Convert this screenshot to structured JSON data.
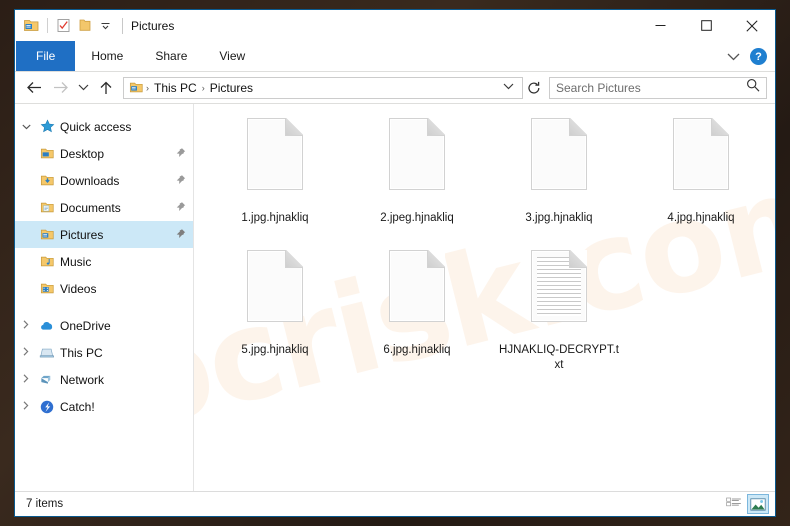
{
  "window": {
    "title": "Pictures",
    "quick_access_icons": [
      "folder-properties-icon",
      "checklist-icon",
      "folder-icon",
      "chevron-down-icon"
    ],
    "controls": {
      "minimize": "─",
      "maximize": "□",
      "close": "✕"
    }
  },
  "ribbon": {
    "tabs": [
      {
        "label": "File",
        "active_style": "file"
      },
      {
        "label": "Home"
      },
      {
        "label": "Share"
      },
      {
        "label": "View"
      }
    ],
    "collapse_label": "⌄",
    "help_label": "?"
  },
  "address": {
    "back": "←",
    "forward": "→",
    "recent": "⌄",
    "up": "↑",
    "crumbs": [
      "This PC",
      "Pictures"
    ],
    "separator": "›",
    "dropdown": "⌄",
    "refresh": "↻"
  },
  "search": {
    "placeholder": "Search Pictures",
    "icon": "search-icon"
  },
  "sidebar": {
    "items": [
      {
        "label": "Quick access",
        "icon": "star-icon",
        "expander": "⌄",
        "level": 0,
        "pinned": false,
        "selected": false
      },
      {
        "label": "Desktop",
        "icon": "folder-desktop-icon",
        "expander": "",
        "level": 1,
        "pinned": true,
        "selected": false
      },
      {
        "label": "Downloads",
        "icon": "folder-downloads-icon",
        "expander": "",
        "level": 1,
        "pinned": true,
        "selected": false
      },
      {
        "label": "Documents",
        "icon": "folder-documents-icon",
        "expander": "",
        "level": 1,
        "pinned": true,
        "selected": false
      },
      {
        "label": "Pictures",
        "icon": "folder-pictures-icon",
        "expander": "",
        "level": 1,
        "pinned": true,
        "selected": true
      },
      {
        "label": "Music",
        "icon": "folder-music-icon",
        "expander": "",
        "level": 1,
        "pinned": false,
        "selected": false
      },
      {
        "label": "Videos",
        "icon": "folder-videos-icon",
        "expander": "",
        "level": 1,
        "pinned": false,
        "selected": false
      },
      {
        "label": "OneDrive",
        "icon": "onedrive-cloud-icon",
        "expander": "›",
        "level": 0,
        "pinned": false,
        "selected": false
      },
      {
        "label": "This PC",
        "icon": "this-pc-icon",
        "expander": "›",
        "level": 0,
        "pinned": false,
        "selected": false
      },
      {
        "label": "Network",
        "icon": "network-icon",
        "expander": "›",
        "level": 0,
        "pinned": false,
        "selected": false
      },
      {
        "label": "Catch!",
        "icon": "catch-app-icon",
        "expander": "›",
        "level": 0,
        "pinned": false,
        "selected": false
      }
    ],
    "pin_glyph": "📌"
  },
  "files": [
    {
      "name": "1.jpg.hjnakliq",
      "icon": "blank-page-icon"
    },
    {
      "name": "2.jpeg.hjnakliq",
      "icon": "blank-page-icon"
    },
    {
      "name": "3.jpg.hjnakliq",
      "icon": "blank-page-icon"
    },
    {
      "name": "4.jpg.hjnakliq",
      "icon": "blank-page-icon"
    },
    {
      "name": "5.jpg.hjnakliq",
      "icon": "blank-page-icon"
    },
    {
      "name": "6.jpg.hjnakliq",
      "icon": "blank-page-icon"
    },
    {
      "name": "HJNAKLIQ-DECRYPT.txt",
      "icon": "text-document-icon"
    }
  ],
  "status": {
    "item_count": "7 items",
    "view_details_label": "details-view-icon",
    "view_large_icons_label": "large-icons-view-icon"
  },
  "watermark": {
    "text": "pcrisk.com"
  },
  "colors": {
    "accent": "#1f6fc4",
    "selection": "#cce8f7",
    "window_border": "#0a5a8f",
    "help_blue": "#1f7fd0",
    "watermark": "#ec963c"
  }
}
